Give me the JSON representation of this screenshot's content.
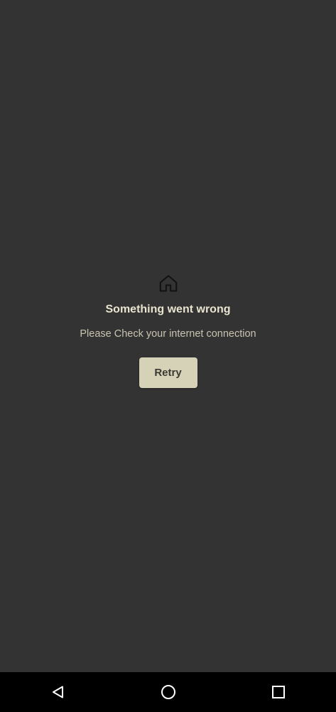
{
  "error": {
    "icon": "home-icon",
    "title": "Something went wrong",
    "message": "Please Check your internet connection",
    "retry_label": "Retry"
  },
  "navigation_bar": {
    "buttons": [
      "back-icon",
      "home-circle-icon",
      "recents-square-icon"
    ]
  },
  "colors": {
    "background": "#333333",
    "title_text": "#e9e4cf",
    "message_text": "#c9c4b0",
    "button_background": "#d6d2b8",
    "nav_bar": "#000000"
  }
}
